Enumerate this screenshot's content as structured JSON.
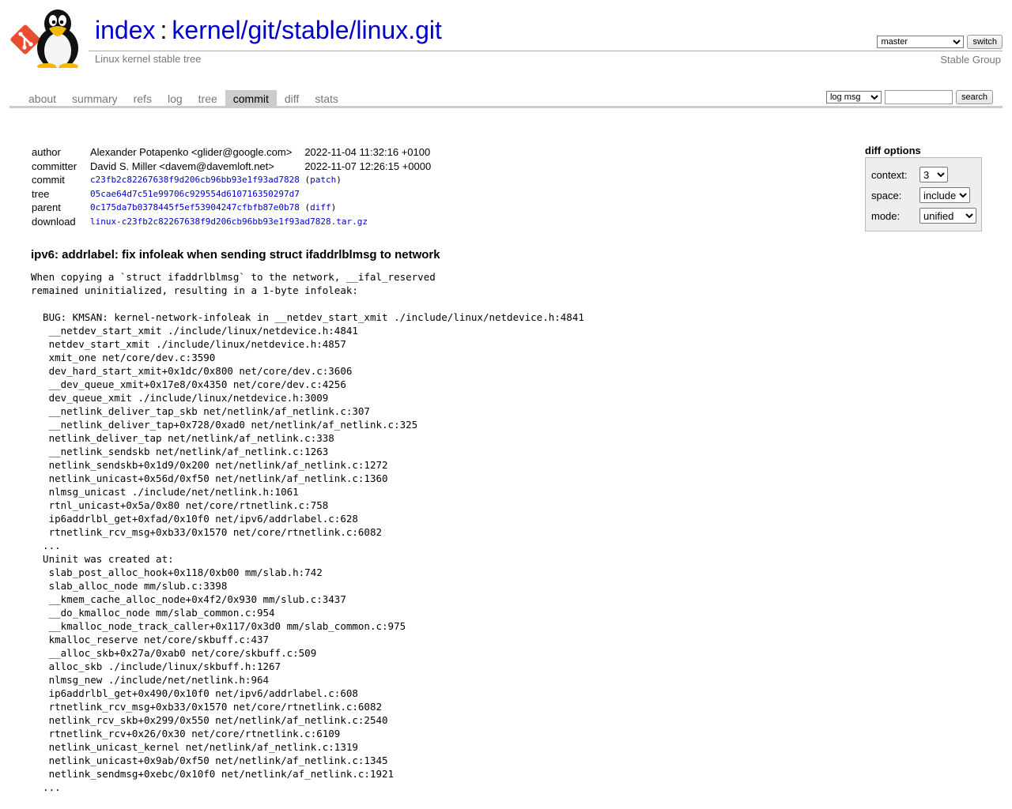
{
  "header": {
    "index_link": "index",
    "separator": ":",
    "repo_path": "kernel/git/stable/linux.git",
    "description": "Linux kernel stable tree",
    "owner": "Stable Group",
    "branch_selected": "master",
    "switch_label": "switch"
  },
  "tabs": [
    {
      "label": "about"
    },
    {
      "label": "summary"
    },
    {
      "label": "refs"
    },
    {
      "label": "log"
    },
    {
      "label": "tree"
    },
    {
      "label": "commit",
      "active": true
    },
    {
      "label": "diff"
    },
    {
      "label": "stats"
    }
  ],
  "search": {
    "mode_selected": "log msg",
    "query": "",
    "button_label": "search"
  },
  "diff_options": {
    "title": "diff options",
    "context": {
      "label": "context:",
      "value": "3"
    },
    "space": {
      "label": "space:",
      "value": "include"
    },
    "mode": {
      "label": "mode:",
      "value": "unified"
    }
  },
  "commit": {
    "author_label": "author",
    "author": "Alexander Potapenko <glider@google.com>",
    "author_date": "2022-11-04 11:32:16 +0100",
    "committer_label": "committer",
    "committer": "David S. Miller <davem@davemloft.net>",
    "committer_date": "2022-11-07 12:26:15 +0000",
    "commit_label": "commit",
    "commit_sha": "c23fb2c82267638f9d206cb96bb93e1f93ad7828",
    "patch_link": "patch",
    "tree_label": "tree",
    "tree_sha": "05cae64d7c51e99706c929554d610716350297d7",
    "parent_label": "parent",
    "parent_sha": "0c175da7b0378445f5ef53904247cfbfb87e0b78",
    "diff_link": "diff",
    "download_label": "download",
    "download_file": "linux-c23fb2c82267638f9d206cb96bb93e1f93ad7828.tar.gz",
    "subject": "ipv6: addrlabel: fix infoleak when sending struct ifaddrlblmsg to network",
    "message": "When copying a `struct ifaddrlblmsg` to the network, __ifal_reserved\nremained uninitialized, resulting in a 1-byte infoleak:\n\n  BUG: KMSAN: kernel-network-infoleak in __netdev_start_xmit ./include/linux/netdevice.h:4841\n   __netdev_start_xmit ./include/linux/netdevice.h:4841\n   netdev_start_xmit ./include/linux/netdevice.h:4857\n   xmit_one net/core/dev.c:3590\n   dev_hard_start_xmit+0x1dc/0x800 net/core/dev.c:3606\n   __dev_queue_xmit+0x17e8/0x4350 net/core/dev.c:4256\n   dev_queue_xmit ./include/linux/netdevice.h:3009\n   __netlink_deliver_tap_skb net/netlink/af_netlink.c:307\n   __netlink_deliver_tap+0x728/0xad0 net/netlink/af_netlink.c:325\n   netlink_deliver_tap net/netlink/af_netlink.c:338\n   __netlink_sendskb net/netlink/af_netlink.c:1263\n   netlink_sendskb+0x1d9/0x200 net/netlink/af_netlink.c:1272\n   netlink_unicast+0x56d/0xf50 net/netlink/af_netlink.c:1360\n   nlmsg_unicast ./include/net/netlink.h:1061\n   rtnl_unicast+0x5a/0x80 net/core/rtnetlink.c:758\n   ip6addrlbl_get+0xfad/0x10f0 net/ipv6/addrlabel.c:628\n   rtnetlink_rcv_msg+0xb33/0x1570 net/core/rtnetlink.c:6082\n  ...\n  Uninit was created at:\n   slab_post_alloc_hook+0x118/0xb00 mm/slab.h:742\n   slab_alloc_node mm/slub.c:3398\n   __kmem_cache_alloc_node+0x4f2/0x930 mm/slub.c:3437\n   __do_kmalloc_node mm/slab_common.c:954\n   __kmalloc_node_track_caller+0x117/0x3d0 mm/slab_common.c:975\n   kmalloc_reserve net/core/skbuff.c:437\n   __alloc_skb+0x27a/0xab0 net/core/skbuff.c:509\n   alloc_skb ./include/linux/skbuff.h:1267\n   nlmsg_new ./include/net/netlink.h:964\n   ip6addrlbl_get+0x490/0x10f0 net/ipv6/addrlabel.c:608\n   rtnetlink_rcv_msg+0xb33/0x1570 net/core/rtnetlink.c:6082\n   netlink_rcv_skb+0x299/0x550 net/netlink/af_netlink.c:2540\n   rtnetlink_rcv+0x26/0x30 net/core/rtnetlink.c:6109\n   netlink_unicast_kernel net/netlink/af_netlink.c:1319\n   netlink_unicast+0x9ab/0xf50 net/netlink/af_netlink.c:1345\n   netlink_sendmsg+0xebc/0x10f0 net/netlink/af_netlink.c:1921\n  ..."
  }
}
